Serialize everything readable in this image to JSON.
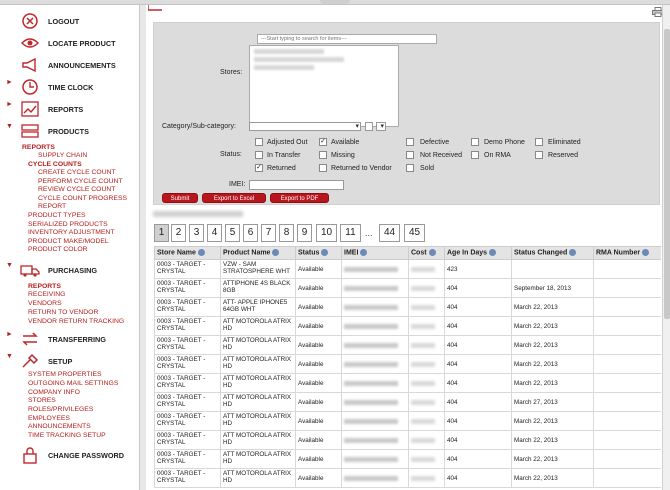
{
  "sidebar": {
    "logout": "LOGOUT",
    "locate_product": "LOCATE PRODUCT",
    "announcements": "ANNOUNCEMENTS",
    "time_clock": "TIME CLOCK",
    "reports": "REPORTS",
    "products": "PRODUCTS",
    "products_sub": [
      "REPORTS",
      "SUPPLY CHAIN",
      "CYCLE COUNTS",
      "CREATE CYCLE COUNT",
      "PERFORM CYCLE COUNT",
      "REVIEW CYCLE COUNT",
      "CYCLE COUNT PROGRESS",
      "REPORT",
      "PRODUCT TYPES",
      "SERIALIZED PRODUCTS",
      "INVENTORY ADJUSTMENT",
      "PRODUCT MAKE/MODEL",
      "PRODUCT COLOR"
    ],
    "purchasing": "PURCHASING",
    "purchasing_sub": [
      "REPORTS",
      "RECEIVING",
      "VENDORS",
      "RETURN TO VENDOR",
      "VENDOR RETURN TRACKING"
    ],
    "transferring": "TRANSFERRING",
    "setup": "SETUP",
    "setup_sub": [
      "SYSTEM PROPERTIES",
      "OUTGOING MAIL SETTINGS",
      "COMPANY INFO",
      "STORES",
      "ROLES/PRIVILEGES",
      "EMPLOYEES",
      "ANNOUNCEMENTS",
      "TIME TRACKING SETUP"
    ],
    "change_password": "CHANGE PASSWORD"
  },
  "filter": {
    "search_placeholder": "---Start typing to search for items---",
    "stores_label": "Stores:",
    "category_label": "Category/Sub-category:",
    "status_label": "Status:",
    "imei_label": "IMEI:",
    "statuses": [
      {
        "label": "Adjusted Out",
        "checked": false
      },
      {
        "label": "Available",
        "checked": true
      },
      {
        "label": "Defective",
        "checked": false
      },
      {
        "label": "Demo Phone",
        "checked": false
      },
      {
        "label": "Eliminated",
        "checked": false
      },
      {
        "label": "In Transfer",
        "checked": false
      },
      {
        "label": "Missing",
        "checked": false
      },
      {
        "label": "Not Received",
        "checked": false
      },
      {
        "label": "On RMA",
        "checked": false
      },
      {
        "label": "Reserved",
        "checked": false
      },
      {
        "label": "Returned",
        "checked": true
      },
      {
        "label": "Returned to Vendor",
        "checked": false
      },
      {
        "label": "Sold",
        "checked": false
      }
    ],
    "submit": "Submit",
    "export_excel": "Export to Excel",
    "export_pdf": "Export to PDF"
  },
  "pagination": {
    "pages": [
      "1",
      "2",
      "3",
      "4",
      "5",
      "6",
      "7",
      "8",
      "9",
      "10",
      "11"
    ],
    "current": "1",
    "ellipsis": "...",
    "tail": [
      "44",
      "45"
    ]
  },
  "table": {
    "columns": [
      "Store Name",
      "Product Name",
      "Status",
      "IMEI",
      "Cost",
      "Age In Days",
      "Status Changed",
      "RMA Number"
    ],
    "rows": [
      {
        "store": "0003 - TARGET - CRYSTAL",
        "product": "VZW - SAM STRATOSPHERE WHT",
        "status": "Available",
        "age": "423",
        "changed": ""
      },
      {
        "store": "0003 - TARGET - CRYSTAL",
        "product": "ATTIPHONE 4S BLACK 8GB",
        "status": "Available",
        "age": "404",
        "changed": "September 18, 2013"
      },
      {
        "store": "0003 - TARGET - CRYSTAL",
        "product": "ATT- APPLE IPHONE5 64GB WHT",
        "status": "Available",
        "age": "404",
        "changed": "March 22, 2013"
      },
      {
        "store": "0003 - TARGET - CRYSTAL",
        "product": "ATT MOTOROLA ATRIX HD",
        "status": "Available",
        "age": "404",
        "changed": "March 22, 2013"
      },
      {
        "store": "0003 - TARGET - CRYSTAL",
        "product": "ATT MOTOROLA ATRIX HD",
        "status": "Available",
        "age": "404",
        "changed": "March 22, 2013"
      },
      {
        "store": "0003 - TARGET - CRYSTAL",
        "product": "ATT MOTOROLA ATRIX HD",
        "status": "Available",
        "age": "404",
        "changed": "March 22, 2013"
      },
      {
        "store": "0003 - TARGET - CRYSTAL",
        "product": "ATT MOTOROLA ATRIX HD",
        "status": "Available",
        "age": "404",
        "changed": "March 22, 2013"
      },
      {
        "store": "0003 - TARGET - CRYSTAL",
        "product": "ATT MOTOROLA ATRIX HD",
        "status": "Available",
        "age": "404",
        "changed": "March 27, 2013"
      },
      {
        "store": "0003 - TARGET - CRYSTAL",
        "product": "ATT MOTOROLA ATRIX HD",
        "status": "Available",
        "age": "404",
        "changed": "March 22, 2013"
      },
      {
        "store": "0003 - TARGET - CRYSTAL",
        "product": "ATT MOTOROLA ATRIX HD",
        "status": "Available",
        "age": "404",
        "changed": "March 22, 2013"
      },
      {
        "store": "0003 - TARGET - CRYSTAL",
        "product": "ATT MOTOROLA ATRIX HD",
        "status": "Available",
        "age": "404",
        "changed": "March 22, 2013"
      },
      {
        "store": "0003 - TARGET - CRYSTAL",
        "product": "ATT MOTOROLA ATRIX HD",
        "status": "Available",
        "age": "404",
        "changed": "March 22, 2013"
      }
    ]
  },
  "colors": {
    "accent": "#b8161d",
    "icon_red": "#c0272d"
  }
}
